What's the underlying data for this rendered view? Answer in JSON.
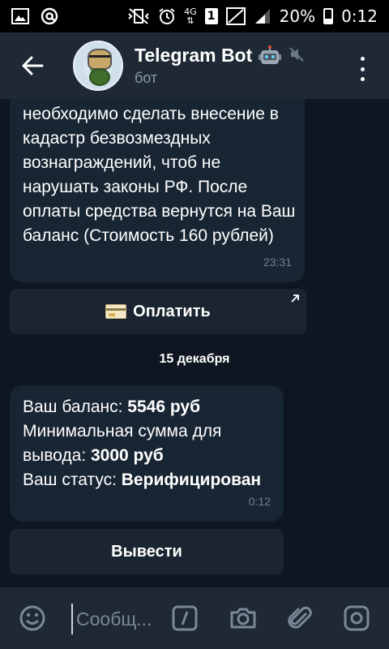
{
  "status_bar": {
    "network": "4G",
    "sim": "1",
    "battery": "20%",
    "time": "0:12"
  },
  "header": {
    "title": "Telegram Bot",
    "subtitle": "бот",
    "icons": [
      "back-arrow-icon",
      "robot-emoji-icon",
      "muted-icon",
      "more-vert-icon"
    ]
  },
  "messages": [
    {
      "text": "необходимо сделать внесение в кадастр безвозмездных вознаграждений, чтоб не нарушать законы РФ. После оплаты средства вернутся на Ваш баланс (Стоимость 160 рублей)",
      "time": "23:31"
    },
    {
      "lines": [
        {
          "label": "Ваш баланс: ",
          "value": "5546 руб"
        },
        {
          "label": "Минимальная сумма для вывода: ",
          "value": "3000 руб"
        },
        {
          "label": "Ваш статус: ",
          "value": "Верифицирован"
        }
      ],
      "time": "0:12"
    }
  ],
  "inline_buttons": {
    "pay": "Оплатить",
    "withdraw": "Вывести"
  },
  "date_separator": "15 декабря",
  "composer": {
    "placeholder": "Сообщ...",
    "icons": [
      "emoji-icon",
      "command-slash-icon",
      "camera-icon",
      "attach-icon",
      "instagram-camera-icon"
    ]
  },
  "colors": {
    "background": "#0e1621",
    "header": "#1f2936",
    "bubble": "#182533",
    "muted_text": "#8b9aa8"
  }
}
